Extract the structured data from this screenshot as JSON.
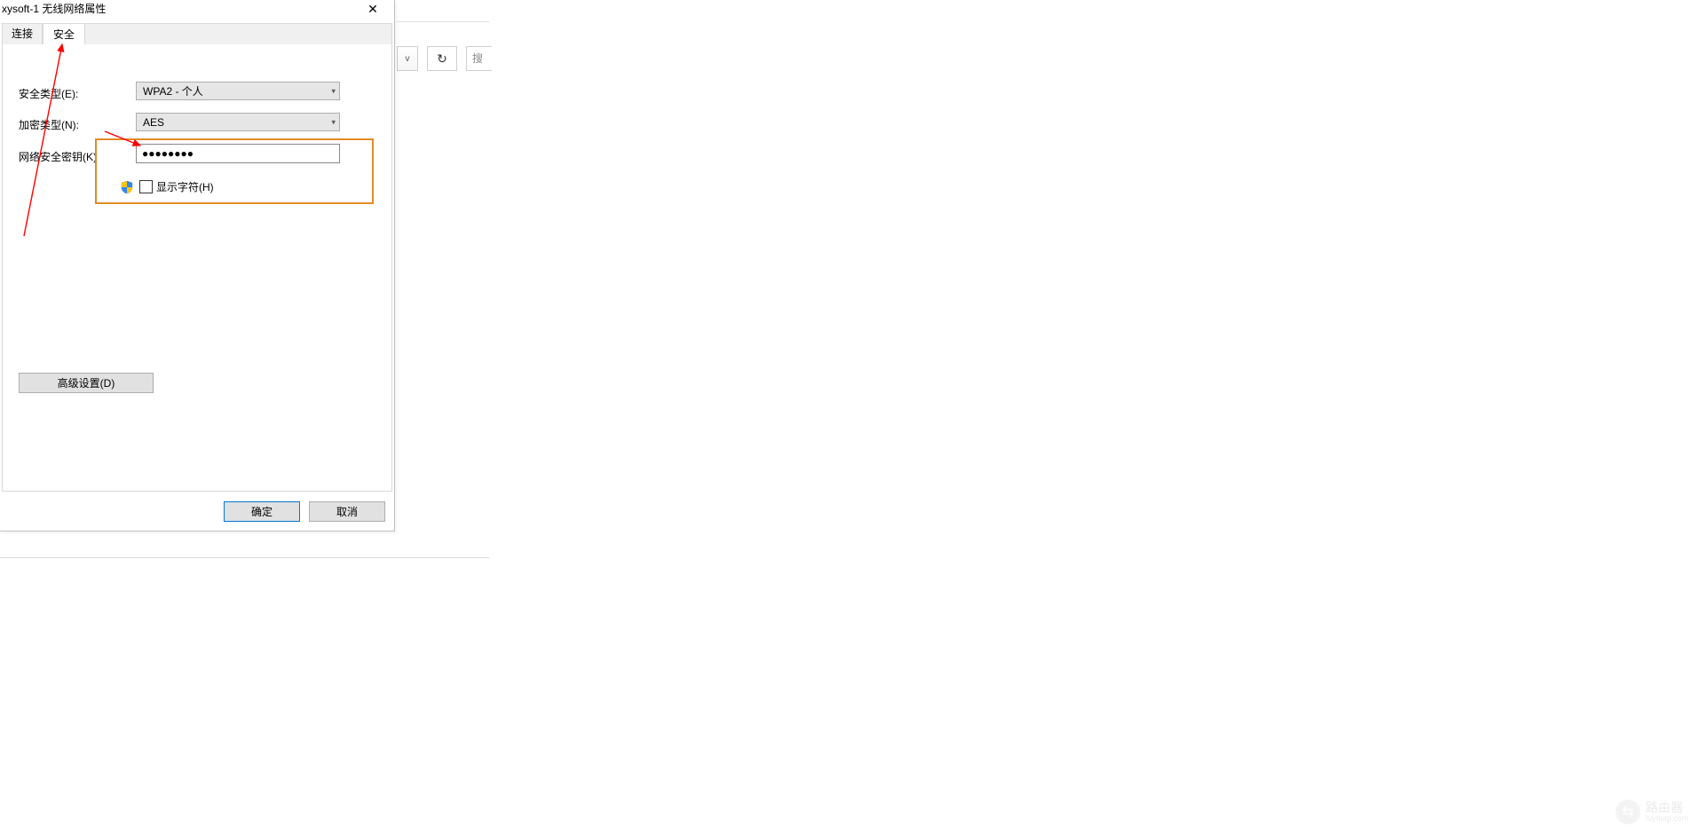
{
  "window": {
    "title": "xysoft-1 无线网络属性",
    "close_glyph": "✕"
  },
  "tabs": {
    "connection": "连接",
    "security": "安全"
  },
  "labels": {
    "security_type": "安全类型(E):",
    "encryption_type": "加密类型(N):",
    "network_key": "网络安全密钥(K)",
    "show_characters": "显示字符(H)"
  },
  "fields": {
    "security_type_value": "WPA2 - 个人",
    "encryption_type_value": "AES",
    "network_key_value": "●●●●●●●●"
  },
  "buttons": {
    "advanced": "高级设置(D)",
    "ok": "确定",
    "cancel": "取消"
  },
  "background": {
    "chevron_glyph": "v",
    "refresh_glyph": "↻",
    "search_partial": "搜"
  },
  "watermark": {
    "main": "路由器",
    "sub": "luyouqi.com",
    "icon_glyph": "⇆"
  },
  "annotation": {
    "highlight_color": "#e38b27",
    "arrow_color": "#ff0000"
  }
}
